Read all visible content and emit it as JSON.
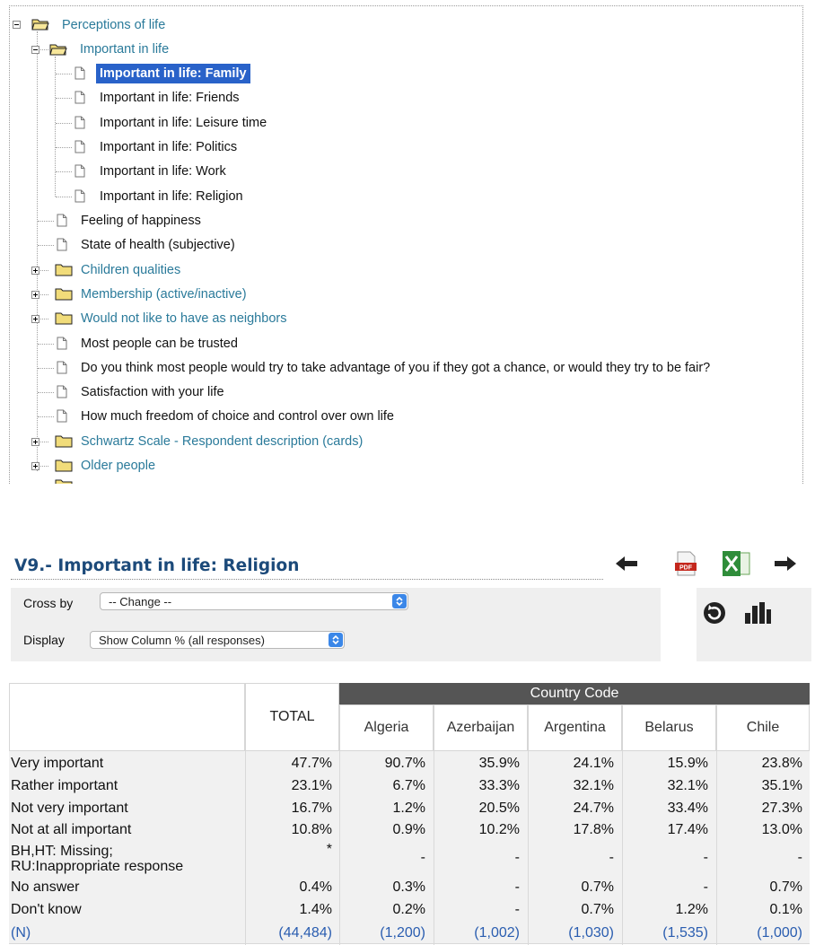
{
  "tree": {
    "root": {
      "label": "Perceptions of life",
      "icon": "folder-open-icon"
    },
    "sub": {
      "label": "Important in life",
      "icon": "folder-open-icon"
    },
    "sub_items": [
      "Important in life: Family",
      "Important in life: Friends",
      "Important in life: Leisure time",
      "Important in life: Politics",
      "Important in life: Work",
      "Important in life: Religion"
    ],
    "selected_index": 0,
    "items": [
      {
        "label": "Feeling of happiness",
        "type": "leaf"
      },
      {
        "label": "State of health (subjective)",
        "type": "leaf"
      },
      {
        "label": "Children qualities",
        "type": "folder"
      },
      {
        "label": "Membership (active/inactive)",
        "type": "folder"
      },
      {
        "label": "Would not like to have as neighbors",
        "type": "folder"
      },
      {
        "label": "Most people can be trusted",
        "type": "leaf"
      },
      {
        "label": "Do you think most people would try to take advantage of you if they got a chance, or would they try to be fair?",
        "type": "leaf"
      },
      {
        "label": "Satisfaction with your life",
        "type": "leaf"
      },
      {
        "label": "How much freedom of choice and control over own life",
        "type": "leaf"
      },
      {
        "label": "Schwartz Scale - Respondent description (cards)",
        "type": "folder"
      },
      {
        "label": "Older people",
        "type": "folder"
      }
    ]
  },
  "title": "V9.- Important in life: Religion",
  "toolbar": {
    "icons": [
      "arrow-left-icon",
      "pdf-icon",
      "excel-icon",
      "arrow-right-icon"
    ],
    "pdf_text": "PDF"
  },
  "controls": {
    "cross_by_label": "Cross by",
    "cross_by_value": "-- Change --",
    "display_label": "Display",
    "display_value": "Show Column % (all responses)"
  },
  "side_tools": [
    "refresh-icon",
    "bar-chart-icon"
  ],
  "table": {
    "group_header": "Country Code",
    "total_header": "TOTAL",
    "columns": [
      "Algeria",
      "Azerbaijan",
      "Argentina",
      "Belarus",
      "Chile"
    ],
    "rows": [
      {
        "label": "Very important",
        "total": "47.7%",
        "values": [
          "90.7%",
          "35.9%",
          "24.1%",
          "15.9%",
          "23.8%"
        ]
      },
      {
        "label": "Rather important",
        "total": "23.1%",
        "values": [
          "6.7%",
          "33.3%",
          "32.1%",
          "32.1%",
          "35.1%"
        ]
      },
      {
        "label": "Not very important",
        "total": "16.7%",
        "values": [
          "1.2%",
          "20.5%",
          "24.7%",
          "33.4%",
          "27.3%"
        ]
      },
      {
        "label": "Not at all important",
        "total": "10.8%",
        "values": [
          "0.9%",
          "10.2%",
          "17.8%",
          "17.4%",
          "13.0%"
        ]
      },
      {
        "label": "BH,HT: Missing;\nRU:Inappropriate response",
        "total": "*",
        "values": [
          "-",
          "-",
          "-",
          "-",
          "-"
        ]
      },
      {
        "label": "No answer",
        "total": "0.4%",
        "values": [
          "0.3%",
          "-",
          "0.7%",
          "-",
          "0.7%"
        ]
      },
      {
        "label": "Don't know",
        "total": "1.4%",
        "values": [
          "0.2%",
          "-",
          "0.7%",
          "1.2%",
          "0.1%"
        ]
      },
      {
        "label": "(N)",
        "total": "(44,484)",
        "values": [
          "(1,200)",
          "(1,002)",
          "(1,030)",
          "(1,535)",
          "(1,000)"
        ]
      }
    ]
  },
  "colors": {
    "folder_label": "#2a7a9a",
    "selection": "#2962c9",
    "title": "#1c4a7a",
    "group_header_bg": "#555555",
    "n_row": "#2a5db0"
  }
}
